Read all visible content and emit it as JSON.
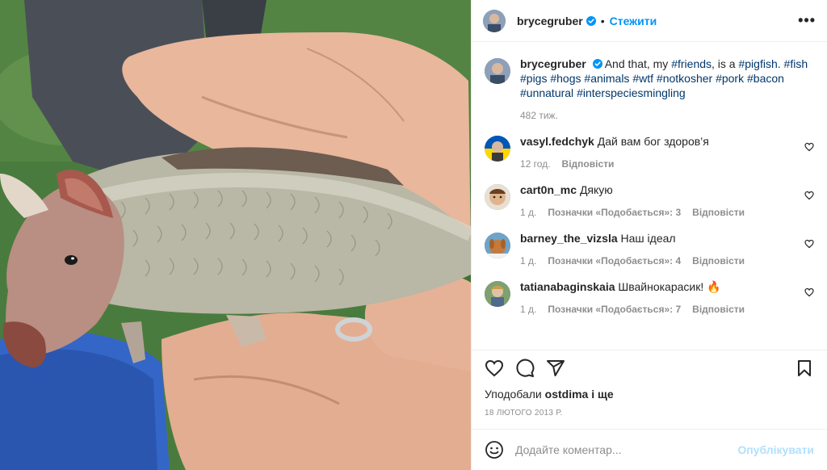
{
  "post": {
    "author": "brycegruber",
    "follow_label": "Стежити",
    "more_label": "•••",
    "separator": "•"
  },
  "caption": {
    "username": "brycegruber",
    "text_plain": "And that, my",
    "tags": [
      "#friends",
      "#pigfish.",
      "#fish",
      "#pigs",
      "#hogs",
      "#animals",
      "#wtf",
      "#notkosher",
      "#pork",
      "#bacon",
      "#unnatural",
      "#interspeciesmingling"
    ],
    "after_friends": ", is a",
    "time": "482 тиж."
  },
  "comments": [
    {
      "username": "vasyl.fedchyk",
      "text": "Дай вам бог здоров’я",
      "time": "12 год.",
      "likes": "",
      "reply": "Відповісти"
    },
    {
      "username": "cart0n_mc",
      "text": "Дякую",
      "time": "1 д.",
      "likes": "Позначки «Подобається»: 3",
      "reply": "Відповісти"
    },
    {
      "username": "barney_the_vizsla",
      "text": "Наш ідеал",
      "time": "1 д.",
      "likes": "Позначки «Подобається»: 4",
      "reply": "Відповісти"
    },
    {
      "username": "tatianabaginskaia",
      "text": "Швайнокарасик! 🔥",
      "time": "1 д.",
      "likes": "Позначки «Подобається»: 7",
      "reply": "Відповісти"
    }
  ],
  "likes_line": {
    "prefix": "Уподобали",
    "user": "ostdima",
    "suffix": "і ще"
  },
  "date": "18 лютого 2013 р.",
  "composer": {
    "placeholder": "Додайте коментар...",
    "publish_label": "Опублікувати"
  },
  "colors": {
    "accent": "#0095f6",
    "link": "#00376b",
    "muted": "#8e8e8e",
    "publish_disabled": "#b2dffc"
  }
}
